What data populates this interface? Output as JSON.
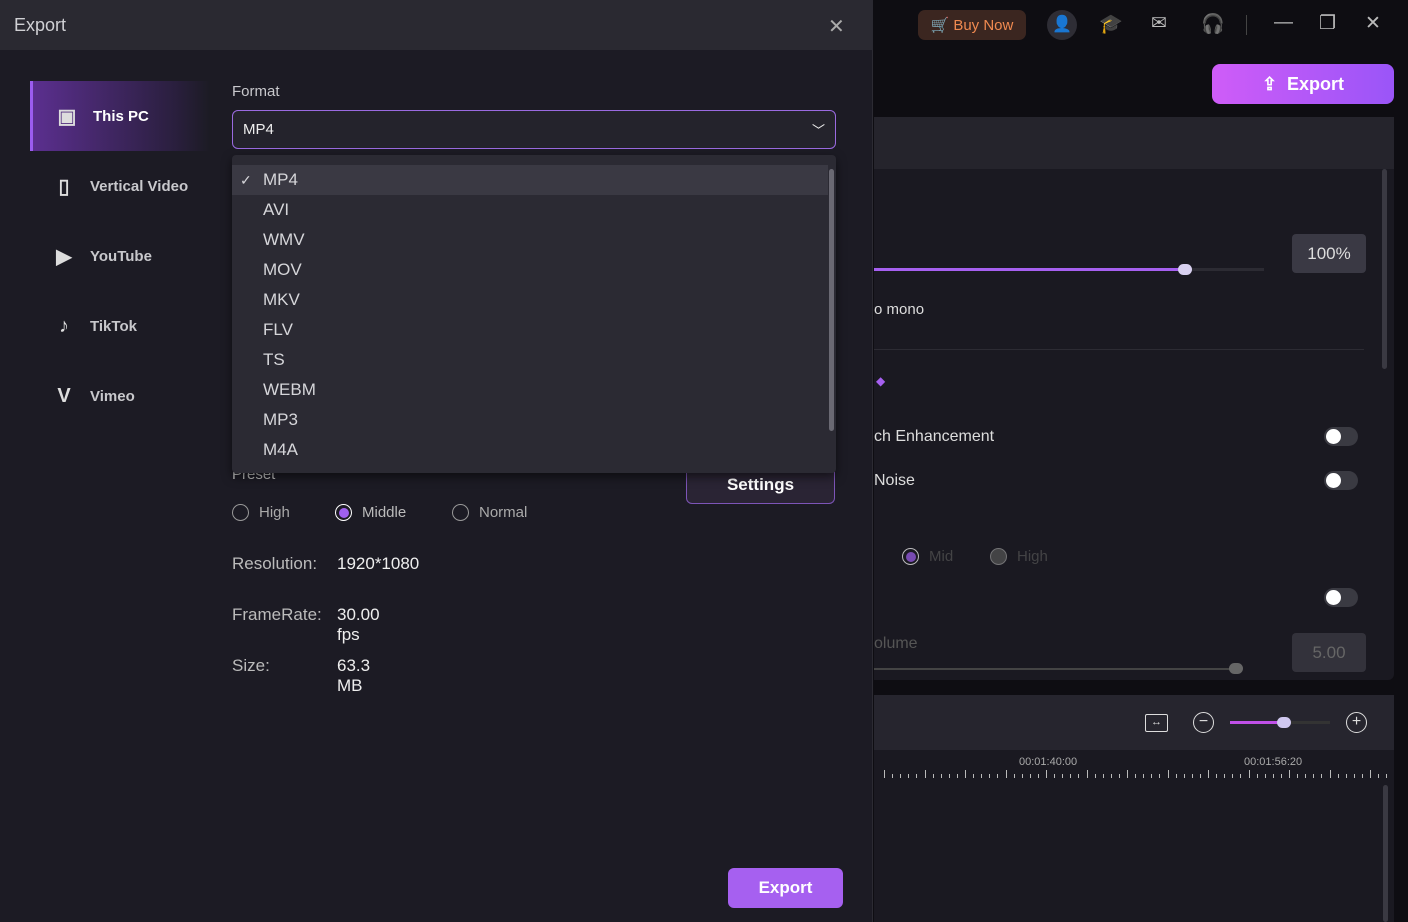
{
  "dialog": {
    "title": "Export",
    "close_icon": "close-icon"
  },
  "sidebar": {
    "items": [
      {
        "label": "This PC",
        "icon": "hard-drive-icon",
        "active": true
      },
      {
        "label": "Vertical Video",
        "icon": "phone-icon"
      },
      {
        "label": "YouTube",
        "icon": "youtube-icon"
      },
      {
        "label": "TikTok",
        "icon": "tiktok-icon"
      },
      {
        "label": "Vimeo",
        "icon": "vimeo-icon"
      }
    ]
  },
  "format": {
    "label": "Format",
    "value": "MP4",
    "options": [
      "MP4",
      "AVI",
      "WMV",
      "MOV",
      "MKV",
      "FLV",
      "TS",
      "WEBM",
      "MP3",
      "M4A"
    ],
    "selected": "MP4"
  },
  "preset": {
    "label": "Preset",
    "options": [
      "High",
      "Middle",
      "Normal"
    ],
    "selected": "Middle",
    "settings_label": "Settings"
  },
  "info": {
    "resolution_label": "Resolution:",
    "resolution": "1920*1080",
    "framerate_label": "FrameRate:",
    "framerate": "30.00 fps",
    "size_label": "Size:",
    "size": "63.3 MB"
  },
  "export_label": "Export",
  "topbar": {
    "buy_now": "Buy Now",
    "main_export": "Export"
  },
  "panel": {
    "volume_value": "100%",
    "volume_fraction": 0.9,
    "mono_text": "o mono",
    "enhancement": "ch Enhancement",
    "noise": "Noise",
    "radio_mid": "Mid",
    "radio_high": "High",
    "volume_label": "olume",
    "volume2_value": "5.00"
  },
  "timeline": {
    "t1": "00:01:40:00",
    "t2": "00:01:56:20"
  },
  "colors": {
    "accent": "#a660f0",
    "buy": "#f08a50"
  }
}
